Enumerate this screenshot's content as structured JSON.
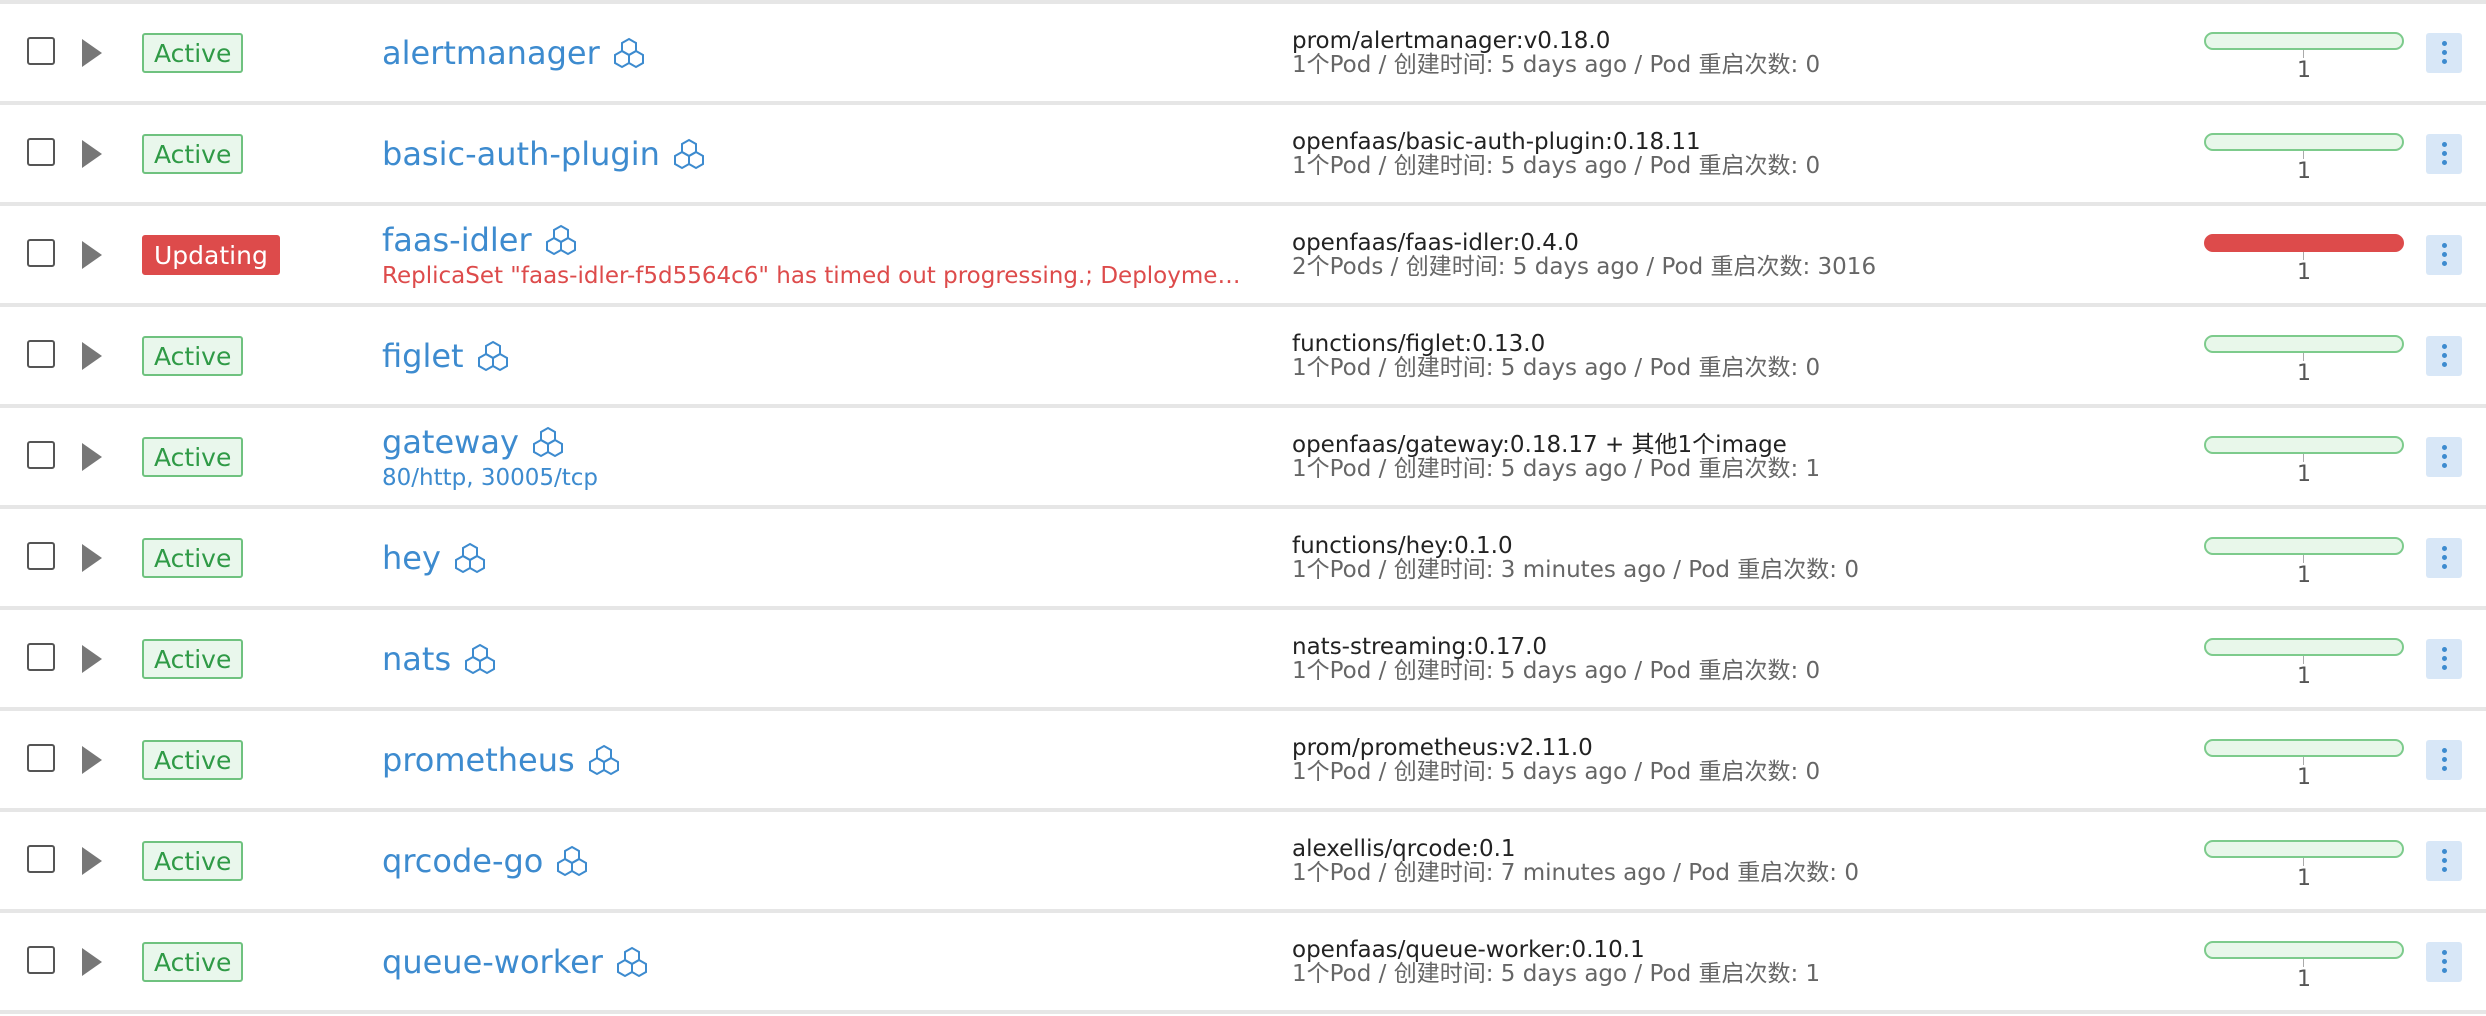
{
  "colors": {
    "link": "#3d8bcf",
    "active_border": "#6fc27f",
    "active_text": "#2f9a46",
    "updating": "#dd4b4b",
    "scale_ok": "#7dcb8c",
    "scale_bad": "#dd4b4b"
  },
  "rows": [
    {
      "state": "Active",
      "state_type": "active",
      "name": "alertmanager",
      "sub": "",
      "sub_type": "",
      "image": "prom/alertmanager:v0.18.0",
      "meta": "1个Pod / 创建时间: 5 days ago / Pod 重启次数: 0",
      "scale": "1",
      "scale_status": "ok"
    },
    {
      "state": "Active",
      "state_type": "active",
      "name": "basic-auth-plugin",
      "sub": "",
      "sub_type": "",
      "image": "openfaas/basic-auth-plugin:0.18.11",
      "meta": "1个Pod / 创建时间: 5 days ago / Pod 重启次数: 0",
      "scale": "1",
      "scale_status": "ok"
    },
    {
      "state": "Updating",
      "state_type": "updating",
      "name": "faas-idler",
      "sub": "ReplicaSet \"faas-idler-f5d5564c6\" has timed out progressing.; Deploymen...",
      "sub_type": "err",
      "image": "openfaas/faas-idler:0.4.0",
      "meta": "2个Pods / 创建时间: 5 days ago / Pod 重启次数: 3016",
      "scale": "1",
      "scale_status": "bad"
    },
    {
      "state": "Active",
      "state_type": "active",
      "name": "figlet",
      "sub": "",
      "sub_type": "",
      "image": "functions/figlet:0.13.0",
      "meta": "1个Pod / 创建时间: 5 days ago / Pod 重启次数: 0",
      "scale": "1",
      "scale_status": "ok"
    },
    {
      "state": "Active",
      "state_type": "active",
      "name": "gateway",
      "sub": "80/http, 30005/tcp",
      "sub_type": "ports",
      "image": "openfaas/gateway:0.18.17 + 其他1个image",
      "meta": "1个Pod / 创建时间: 5 days ago / Pod 重启次数: 1",
      "scale": "1",
      "scale_status": "ok"
    },
    {
      "state": "Active",
      "state_type": "active",
      "name": "hey",
      "sub": "",
      "sub_type": "",
      "image": "functions/hey:0.1.0",
      "meta": "1个Pod / 创建时间: 3 minutes ago / Pod 重启次数: 0",
      "scale": "1",
      "scale_status": "ok"
    },
    {
      "state": "Active",
      "state_type": "active",
      "name": "nats",
      "sub": "",
      "sub_type": "",
      "image": "nats-streaming:0.17.0",
      "meta": "1个Pod / 创建时间: 5 days ago / Pod 重启次数: 0",
      "scale": "1",
      "scale_status": "ok"
    },
    {
      "state": "Active",
      "state_type": "active",
      "name": "prometheus",
      "sub": "",
      "sub_type": "",
      "image": "prom/prometheus:v2.11.0",
      "meta": "1个Pod / 创建时间: 5 days ago / Pod 重启次数: 0",
      "scale": "1",
      "scale_status": "ok"
    },
    {
      "state": "Active",
      "state_type": "active",
      "name": "qrcode-go",
      "sub": "",
      "sub_type": "",
      "image": "alexellis/qrcode:0.1",
      "meta": "1个Pod / 创建时间: 7 minutes ago / Pod 重启次数: 0",
      "scale": "1",
      "scale_status": "ok"
    },
    {
      "state": "Active",
      "state_type": "active",
      "name": "queue-worker",
      "sub": "",
      "sub_type": "",
      "image": "openfaas/queue-worker:0.10.1",
      "meta": "1个Pod / 创建时间: 5 days ago / Pod 重启次数: 1",
      "scale": "1",
      "scale_status": "ok"
    }
  ]
}
